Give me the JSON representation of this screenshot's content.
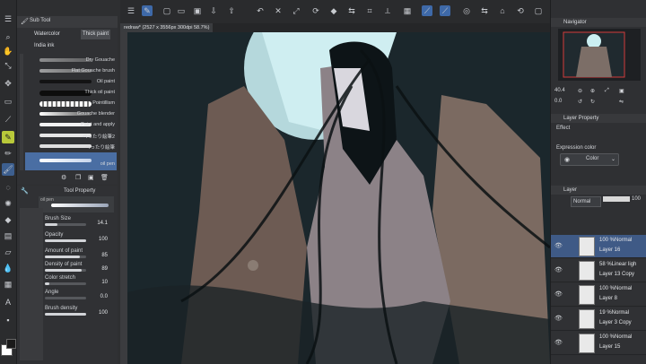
{
  "subtool": {
    "title": "Sub Tool",
    "tabs": [
      "Watercolor",
      "Thick paint",
      "India ink"
    ],
    "brushes": [
      "Dry Gouache",
      "Flat Gouache brush",
      "Oil paint",
      "Thick oil paint",
      "Pointillism",
      "Gouache blender",
      "Paint and apply",
      "ペったり絵筆2",
      "ペったり絵筆",
      "oil pen"
    ]
  },
  "toolprop": {
    "title": "Tool Property",
    "preset_label": "oil pen",
    "props": [
      {
        "name": "Brush Size",
        "value": "14.1",
        "level": 0.3
      },
      {
        "name": "Opacity",
        "value": "100",
        "level": 1.0
      },
      {
        "name": "Amount of paint",
        "value": "85",
        "level": 0.85
      },
      {
        "name": "Density of paint",
        "value": "89",
        "level": 0.89
      },
      {
        "name": "Color stretch",
        "value": "10",
        "level": 0.1
      },
      {
        "name": "Angle",
        "value": "0.0",
        "level": 0.0
      },
      {
        "name": "Brush density",
        "value": "100",
        "level": 1.0
      }
    ]
  },
  "document": {
    "tab_label": "redraw* (2527 x 3556px 300dpi 58.7%)"
  },
  "navigator": {
    "title": "Navigator",
    "zoom": "40.4",
    "angle": "0.0"
  },
  "layer_property": {
    "title": "Layer Property",
    "effect_label": "Effect",
    "expression_color_label": "Expression color",
    "color_value": "Color"
  },
  "layers": {
    "title": "Layer",
    "blend_mode": "Normal",
    "opacity": "100",
    "rows": [
      {
        "mode": "100 %Normal",
        "name": "Layer 16"
      },
      {
        "mode": "58 %Linear ligh",
        "name": "Layer 13 Copy"
      },
      {
        "mode": "100 %Normal",
        "name": "Layer 8"
      },
      {
        "mode": "19 %Normal",
        "name": "Layer 3 Copy"
      },
      {
        "mode": "100 %Normal",
        "name": "Layer 15"
      }
    ]
  },
  "colors": {
    "accent": "#3e69a8",
    "canvas_bg": "#1f2a2f",
    "panel_bg": "#303134"
  }
}
